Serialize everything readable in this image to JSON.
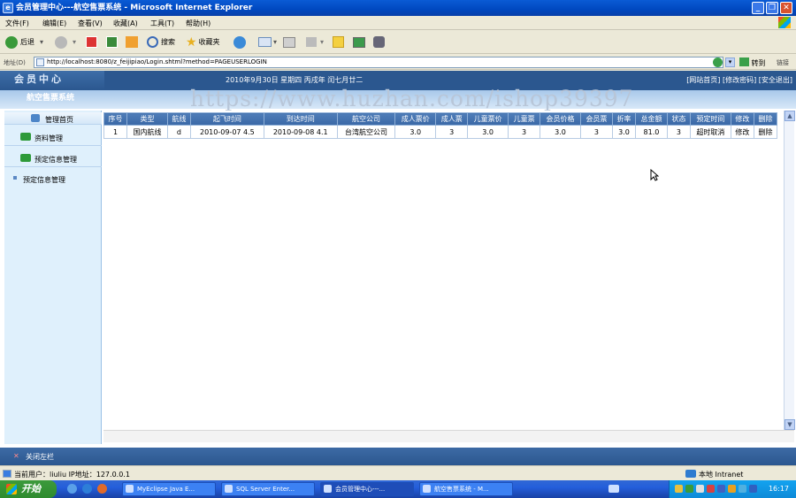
{
  "window": {
    "title": "会员管理中心---航空售票系统 - Microsoft Internet Explorer"
  },
  "menu": [
    "文件(F)",
    "编辑(E)",
    "查看(V)",
    "收藏(A)",
    "工具(T)",
    "帮助(H)"
  ],
  "toolbar": {
    "back": "后退",
    "search": "搜索",
    "favorites": "收藏夹"
  },
  "address": {
    "label": "地址(D)",
    "url": "http://localhost:8080/z_feijipiao/Login.shtml?method=PAGEUSERLOGIN",
    "go": "转到",
    "links": "链接"
  },
  "page": {
    "logo": "会员中心",
    "system_name": "航空售票系统",
    "date": "2010年9月30日  星期四  丙戌年 闰七月廿二",
    "top_links": "[网站首页] [修改密码] [安全退出]",
    "watermark": "https://www.huzhan.com/ishop39397"
  },
  "sidebar": {
    "title": "管理首页",
    "items": [
      "资料管理",
      "预定信息管理"
    ],
    "sub": "预定信息管理"
  },
  "table": {
    "headers": [
      "序号",
      "类型",
      "航线",
      "起飞时间",
      "到达时间",
      "航空公司",
      "成人票价",
      "成人票",
      "儿童票价",
      "儿童票",
      "会员价格",
      "会员票",
      "折率",
      "总金额",
      "状态",
      "预定时间",
      "修改",
      "删除"
    ],
    "rows": [
      [
        "1",
        "国内航线",
        "d",
        "2010-09-07 4.5",
        "2010-09-08 4.1",
        "台湾航空公司",
        "3.0",
        "3",
        "3.0",
        "3",
        "3.0",
        "3",
        "3.0",
        "81.0",
        "3",
        "超时取消",
        "修改",
        "删除"
      ]
    ]
  },
  "footer": {
    "close_nav": "关闭左栏"
  },
  "status": {
    "text": "当前用户：liuliu   IP地址：127.0.0.1",
    "zone": "本地 Intranet"
  },
  "taskbar": {
    "start": "开始",
    "tasks": [
      "MyEclipse Java E...",
      "SQL Server Enter...",
      "会员管理中心---...",
      "航空售票系统 - M..."
    ],
    "clock": "16:17"
  },
  "colors": {
    "header_blue": "#2b578f",
    "sidebar_bg": "#dff0fc",
    "table_header": "#3a68a6"
  }
}
